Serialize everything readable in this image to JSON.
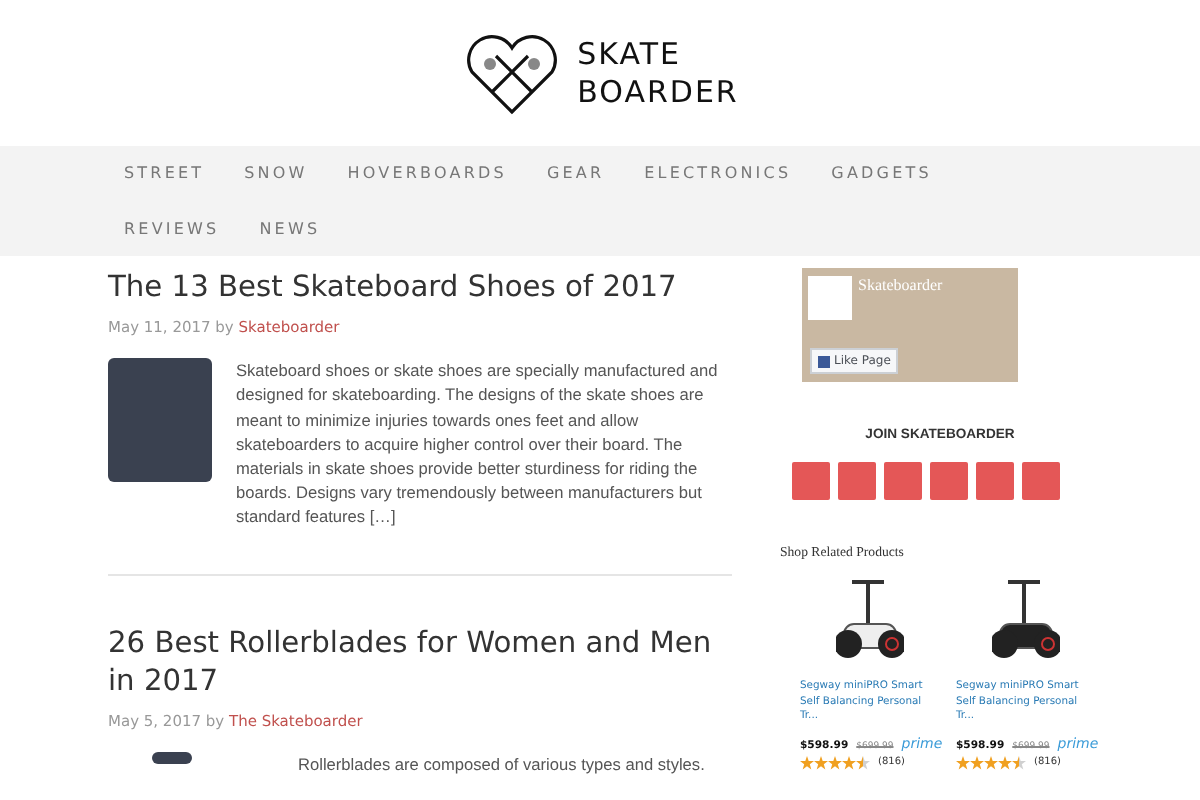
{
  "logo": {
    "lines": [
      "SKATE",
      "BOARDER"
    ]
  },
  "nav": {
    "items": [
      {
        "label": "STREET"
      },
      {
        "label": "SNOW"
      },
      {
        "label": "HOVERBOARDS"
      },
      {
        "label": "GEAR"
      },
      {
        "label": "ELECTRONICS"
      },
      {
        "label": "GADGETS"
      },
      {
        "label": "REVIEWS"
      },
      {
        "label": "NEWS"
      }
    ]
  },
  "posts": [
    {
      "title": "The 13 Best Skateboard Shoes of 2017",
      "date": "May 11, 2017",
      "by": "by",
      "author": "Skateboarder",
      "excerpt": "Skateboard shoes or skate shoes are specially manufactured and designed for skateboarding. The designs of the skate shoes are meant to minimize injuries towards ones feet and allow skateboarders to acquire higher control over their board.  The materials in skate shoes provide better sturdiness for riding the boards. Designs vary tremendously between manufacturers but standard features […]"
    },
    {
      "title": "26 Best Rollerblades for Women and Men in 2017",
      "date": "May 5, 2017",
      "by": "by",
      "author": "The Skateboarder",
      "excerpt": "Rollerblades are composed of various types and styles."
    }
  ],
  "sidebar": {
    "facebook": {
      "page_name": "Skateboarder",
      "like_label": "Like Page"
    },
    "join_title": "JOIN SKATEBOARDER",
    "shop_title": "Shop Related Products",
    "products": [
      {
        "title": "Segway miniPRO Smart Self Balancing Personal Tr...",
        "price": "$598.99",
        "old_price": "$699.99",
        "prime": "prime",
        "stars": 4.5,
        "reviews": "(816)"
      },
      {
        "title": "Segway miniPRO Smart Self Balancing Personal Tr...",
        "price": "$598.99",
        "old_price": "$699.99",
        "prime": "prime",
        "stars": 4.5,
        "reviews": "(816)"
      }
    ]
  }
}
